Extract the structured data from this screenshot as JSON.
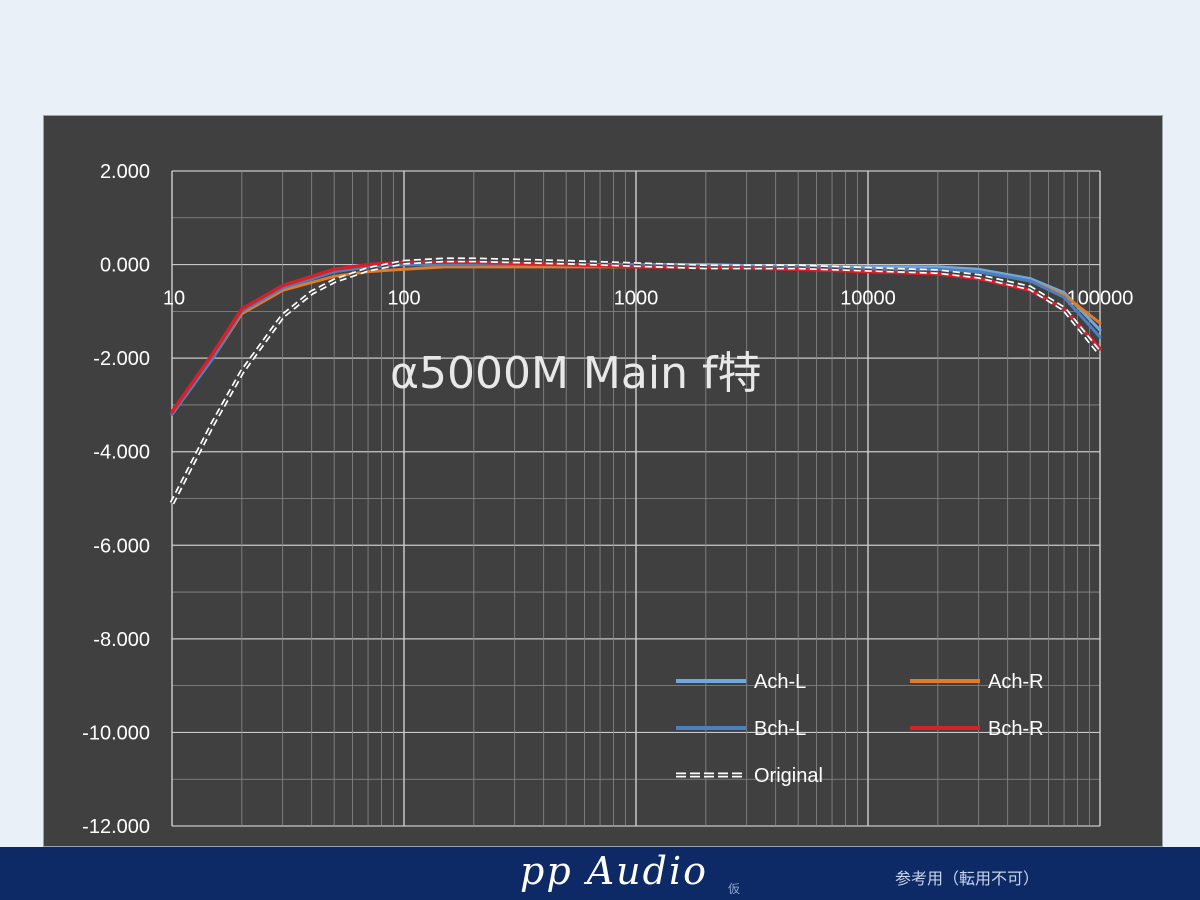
{
  "chart_data": {
    "type": "line",
    "title": "α5000M Main f特",
    "x_scale": "log",
    "xlim": [
      10,
      100000
    ],
    "ylim": [
      -12,
      2
    ],
    "x_ticks": [
      10,
      100,
      1000,
      10000,
      100000
    ],
    "x_tick_labels": [
      "10",
      "100",
      "1000",
      "10000",
      "100000"
    ],
    "y_ticks": [
      2,
      0,
      -2,
      -4,
      -6,
      -8,
      -10,
      -12
    ],
    "y_tick_labels": [
      "2.000",
      "0.000",
      "-2.000",
      "-4.000",
      "-6.000",
      "-8.000",
      "-10.000",
      "-12.000"
    ],
    "grid": true,
    "legend_position": "bottom-right",
    "series": [
      {
        "name": "Ach-L",
        "color": "#6fa8dc",
        "style": "solid",
        "x": [
          10,
          15,
          20,
          30,
          50,
          70,
          100,
          150,
          200,
          500,
          1000,
          2000,
          5000,
          10000,
          20000,
          30000,
          50000,
          70000,
          100000
        ],
        "y": [
          -3.2,
          -2.0,
          -1.0,
          -0.5,
          -0.15,
          -0.05,
          0.0,
          0.0,
          0.0,
          0.0,
          0.0,
          0.0,
          -0.05,
          -0.05,
          -0.05,
          -0.1,
          -0.3,
          -0.6,
          -1.4
        ]
      },
      {
        "name": "Ach-R",
        "color": "#e07b2a",
        "style": "solid",
        "x": [
          10,
          15,
          20,
          30,
          50,
          70,
          100,
          150,
          200,
          500,
          1000,
          2000,
          5000,
          10000,
          20000,
          30000,
          50000,
          70000,
          100000
        ],
        "y": [
          -3.2,
          -2.0,
          -1.05,
          -0.55,
          -0.25,
          -0.15,
          -0.1,
          -0.05,
          -0.05,
          -0.05,
          -0.05,
          -0.05,
          -0.05,
          -0.1,
          -0.1,
          -0.15,
          -0.35,
          -0.65,
          -1.25
        ]
      },
      {
        "name": "Bch-L",
        "color": "#4a7fc1",
        "style": "solid",
        "x": [
          10,
          15,
          20,
          30,
          50,
          70,
          100,
          150,
          200,
          500,
          1000,
          2000,
          5000,
          10000,
          20000,
          30000,
          50000,
          70000,
          100000
        ],
        "y": [
          -3.2,
          -2.0,
          -1.0,
          -0.5,
          -0.15,
          -0.05,
          0.0,
          0.0,
          0.0,
          0.0,
          0.0,
          -0.05,
          -0.05,
          -0.1,
          -0.1,
          -0.15,
          -0.35,
          -0.7,
          -1.55
        ]
      },
      {
        "name": "Bch-R",
        "color": "#d8202a",
        "style": "solid",
        "x": [
          10,
          15,
          20,
          30,
          50,
          70,
          100,
          150,
          200,
          500,
          1000,
          2000,
          5000,
          10000,
          20000,
          30000,
          50000,
          70000,
          100000
        ],
        "y": [
          -3.15,
          -1.9,
          -0.95,
          -0.45,
          -0.1,
          0.0,
          0.05,
          0.05,
          0.05,
          0.0,
          -0.05,
          -0.05,
          -0.1,
          -0.15,
          -0.2,
          -0.3,
          -0.55,
          -0.95,
          -1.8
        ]
      },
      {
        "name": "Original",
        "color": "#ffffff",
        "style": "dashed",
        "x": [
          10,
          15,
          20,
          30,
          40,
          50,
          70,
          100,
          150,
          200,
          500,
          1000,
          2000,
          5000,
          10000,
          20000,
          30000,
          50000,
          70000,
          100000
        ],
        "y": [
          -5.1,
          -3.4,
          -2.3,
          -1.1,
          -0.6,
          -0.35,
          -0.1,
          0.05,
          0.1,
          0.1,
          0.05,
          0.0,
          -0.05,
          -0.05,
          -0.1,
          -0.15,
          -0.25,
          -0.5,
          -0.95,
          -1.9
        ]
      }
    ]
  },
  "footer": {
    "brand": "pp Audio",
    "brand_mark": "仮",
    "notice": "参考用（転用不可）"
  }
}
